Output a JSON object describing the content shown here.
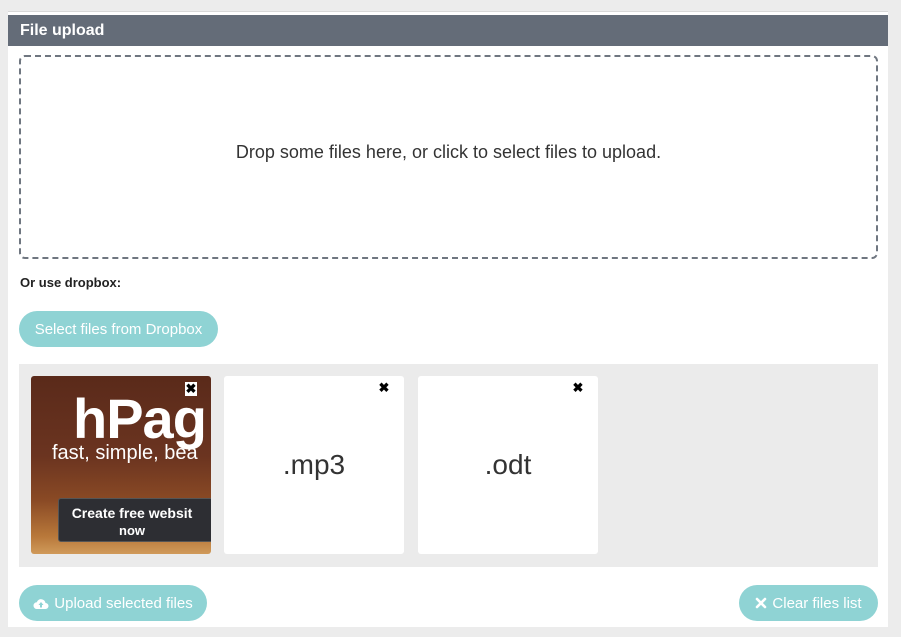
{
  "panel": {
    "title": "File upload"
  },
  "dropzone": {
    "text": "Drop some files here, or click to select files to upload."
  },
  "dropbox": {
    "label": "Or use dropbox:",
    "button_label": "Select files from Dropbox"
  },
  "files": [
    {
      "type": "image",
      "thumbnail": {
        "logo": "hPag",
        "tagline": "fast, simple, bea",
        "cta_line1": "Create free websit",
        "cta_line2": "now"
      },
      "remove_symbol": "✖"
    },
    {
      "type": "extension",
      "ext_label": ".mp3",
      "remove_symbol": "✖"
    },
    {
      "type": "extension",
      "ext_label": ".odt",
      "remove_symbol": "✖"
    }
  ],
  "actions": {
    "upload_label": "Upload selected files",
    "upload_icon": "cloud-upload-icon",
    "clear_label": "Clear files list",
    "clear_icon": "times-icon"
  },
  "colors": {
    "header_bg": "#646c78",
    "button_bg": "#8fd3d4",
    "file_area_bg": "#ebebeb"
  }
}
